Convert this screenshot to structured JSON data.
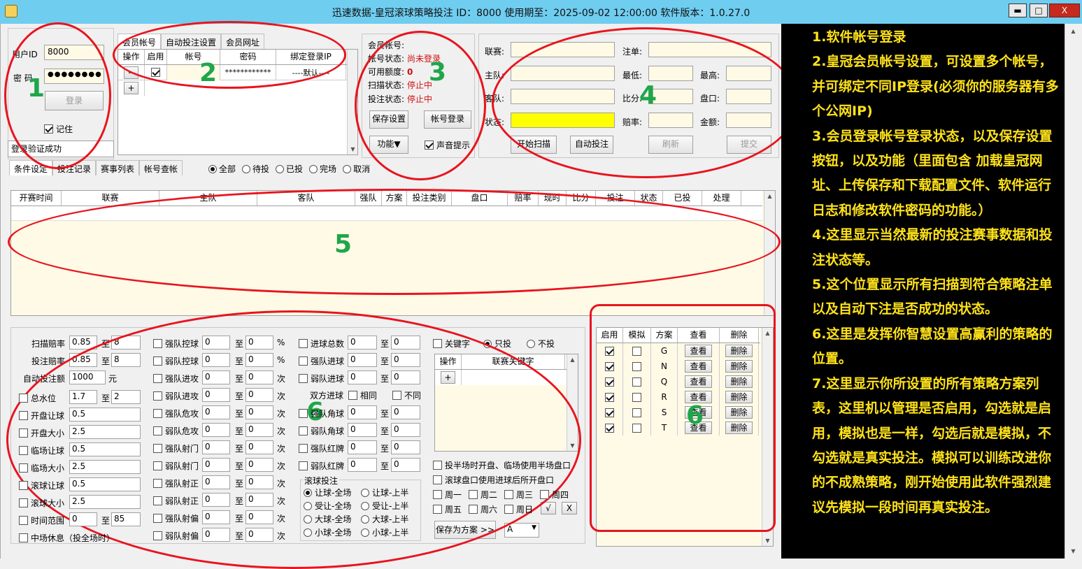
{
  "window": {
    "title": "迅速数据-皇冠滚球策略投注 ID：8000 使用期至：2025-09-02 12:00:00 软件版本：1.0.27.0",
    "minimize": "▬",
    "maximize": "□",
    "close": "X"
  },
  "login": {
    "user_label": "用户ID",
    "user_value": "8000",
    "pwd_label": "密  码",
    "pwd_value": "●●●●●●●●",
    "login_button": "登录",
    "remember_label": "记住",
    "status": "登录验证成功"
  },
  "member": {
    "tabs": [
      "会员帐号",
      "自动投注设置",
      "会员网址"
    ],
    "columns": [
      "操作",
      "启用",
      "帐号",
      "密码",
      "绑定登录IP"
    ],
    "row": {
      "minus": "−",
      "plus": "+",
      "password": "************",
      "ip": "----默认----"
    }
  },
  "account_status": {
    "account_label": "会员帐号:",
    "state_label": "帐号状态:",
    "state_value": "尚未登录",
    "credit_label": "可用额度:",
    "credit_value": "0",
    "scan_label": "扫描状态:",
    "scan_value": "停止中",
    "bet_label": "投注状态:",
    "bet_value": "停止中",
    "save_button": "保存设置",
    "login_button": "帐号登录",
    "func_button": "功能▼",
    "sound_label": "声音提示"
  },
  "bet_panel": {
    "league": "联赛:",
    "order": "注单:",
    "home": "主队:",
    "min": "最低:",
    "max": "最高:",
    "away": "客队:",
    "score": "比分:",
    "handicap": "盘口:",
    "state": "状态:",
    "odds": "赔率:",
    "amount": "金额:",
    "start_scan": "开始扫描",
    "auto_bet": "自动投注",
    "refresh": "刷新",
    "submit": "提交"
  },
  "main_tabs": [
    "条件设定",
    "投注记录",
    "赛事列表",
    "帐号查帐"
  ],
  "filters": [
    "全部",
    "待投",
    "已投",
    "完场",
    "取消"
  ],
  "bet_table": {
    "columns": [
      "开赛时间",
      "联赛",
      "主队",
      "客队",
      "强队",
      "方案",
      "投注类别",
      "盘口",
      "赔率",
      "现时",
      "比分",
      "投注",
      "状态",
      "已投",
      "处理"
    ]
  },
  "strategy": {
    "scan_odds": {
      "label": "扫描赔率",
      "from": "0.85",
      "to": "8"
    },
    "bet_odds": {
      "label": "投注赔率",
      "from": "0.85",
      "to": "8"
    },
    "auto_amount": {
      "label": "自动投注额",
      "value": "1000",
      "unit": "元"
    },
    "to": "至",
    "left_rows": [
      {
        "label": "总水位",
        "a": "1.7",
        "b": "2"
      },
      {
        "label": "开盘让球",
        "a": "0.5"
      },
      {
        "label": "开盘大小",
        "a": "2.5"
      },
      {
        "label": "临场让球",
        "a": "0.5"
      },
      {
        "label": "临场大小",
        "a": "2.5"
      },
      {
        "label": "滚球让球",
        "a": "0.5"
      },
      {
        "label": "滚球大小",
        "a": "2.5"
      },
      {
        "label": "时间范围",
        "a": "0",
        "b": "85"
      },
      {
        "label": "中场休息（投全场时）"
      }
    ],
    "mid_rows": [
      {
        "label": "强队控球",
        "a": "0",
        "b": "0",
        "unit": "%"
      },
      {
        "label": "弱队控球",
        "a": "0",
        "b": "0",
        "unit": "%"
      },
      {
        "label": "强队进攻",
        "a": "0",
        "b": "0",
        "unit": "次"
      },
      {
        "label": "弱队进攻",
        "a": "0",
        "b": "0",
        "unit": "次"
      },
      {
        "label": "强队危攻",
        "a": "0",
        "b": "0",
        "unit": "次"
      },
      {
        "label": "弱队危攻",
        "a": "0",
        "b": "0",
        "unit": "次"
      },
      {
        "label": "强队射门",
        "a": "0",
        "b": "0",
        "unit": "次"
      },
      {
        "label": "弱队射门",
        "a": "0",
        "b": "0",
        "unit": "次"
      },
      {
        "label": "强队射正",
        "a": "0",
        "b": "0",
        "unit": "次"
      },
      {
        "label": "弱队射正",
        "a": "0",
        "b": "0",
        "unit": "次"
      },
      {
        "label": "强队射偏",
        "a": "0",
        "b": "0",
        "unit": "次"
      },
      {
        "label": "弱队射偏",
        "a": "0",
        "b": "0",
        "unit": "次"
      }
    ],
    "right_rows": [
      {
        "label": "进球总数",
        "a": "0",
        "b": "0"
      },
      {
        "label": "强队进球",
        "a": "0",
        "b": "0"
      },
      {
        "label": "弱队进球",
        "a": "0",
        "b": "0"
      }
    ],
    "both_goal": "双方进球",
    "same": "相同",
    "diff": "不同",
    "right_rows2": [
      {
        "label": "强队角球",
        "a": "0",
        "b": "0"
      },
      {
        "label": "弱队角球",
        "a": "0",
        "b": "0"
      },
      {
        "label": "强队红牌",
        "a": "0",
        "b": "0"
      },
      {
        "label": "弱队红牌",
        "a": "0",
        "b": "0"
      }
    ],
    "rolling_title": "滚球投注",
    "rolling_options": [
      "让球-全场",
      "让球-上半",
      "受让-全场",
      "受让-上半",
      "大球-全场",
      "大球-上半",
      "小球-全场",
      "小球-上半"
    ],
    "keyword": "关键字",
    "only_bet": "只投",
    "no_bet": "不投",
    "kw_columns": [
      "操作",
      "联赛关键字"
    ],
    "kw_plus": "+",
    "half_option": "投半场时开盘、临场使用半场盘口",
    "rolling_option": "滚球盘口使用进球后所开盘口",
    "weekdays": [
      "周一",
      "周二",
      "周三",
      "周四",
      "周五",
      "周六",
      "周日"
    ],
    "check_all": "√",
    "clear_all": "X",
    "save_scheme": "保存为方案 >>",
    "scheme_select": "A"
  },
  "schemes": {
    "columns": [
      "启用",
      "模拟",
      "方案",
      "查看",
      "删除"
    ],
    "rows": [
      {
        "name": "G",
        "view": "查看",
        "del": "删除"
      },
      {
        "name": "N",
        "view": "查看",
        "del": "删除"
      },
      {
        "name": "Q",
        "view": "查看",
        "del": "删除"
      },
      {
        "name": "R",
        "view": "查看",
        "del": "删除"
      },
      {
        "name": "S",
        "view": "查看",
        "del": "删除"
      },
      {
        "name": "T",
        "view": "查看",
        "del": "删除"
      }
    ]
  },
  "annotations": [
    "1",
    "2",
    "3",
    "4",
    "5",
    "6",
    "6"
  ],
  "notes": "1.软件帐号登录\n2.皇冠会员帐号设置，可设置多个帐号，并可绑定不同IP登录(必须你的服务器有多个公网IP)\n3.会员登录帐号登录状态，以及保存设置按钮，以及功能（里面包含 加载皇冠网址、上传保存和下载配置文件、软件运行日志和修改软件密码的功能。）\n4.这里显示当然最新的投注赛事数据和投注状态等。\n5.这个位置显示所有扫描到符合策略注单以及自动下注是否成功的状态。\n6.这里是发挥你智慧设置高赢利的策略的位置。\n7.这里显示你所设置的所有策略方案列表，这里机以管理是否启用，勾选就是启用，模拟也是一样，勾选后就是模拟，不勾选就是真实投注。模拟可以训练改进你的不成熟策略，刚开始使用此软件强烈建议先模拟一段时间再真实投注。",
  "colors": {
    "titlebar": "#6fcdf0",
    "annotation": "#e8141e",
    "annotation_number": "#1fa64a",
    "notes_text": "#ffe21a",
    "cream": "#fffae6",
    "highlight": "#ffff00"
  }
}
